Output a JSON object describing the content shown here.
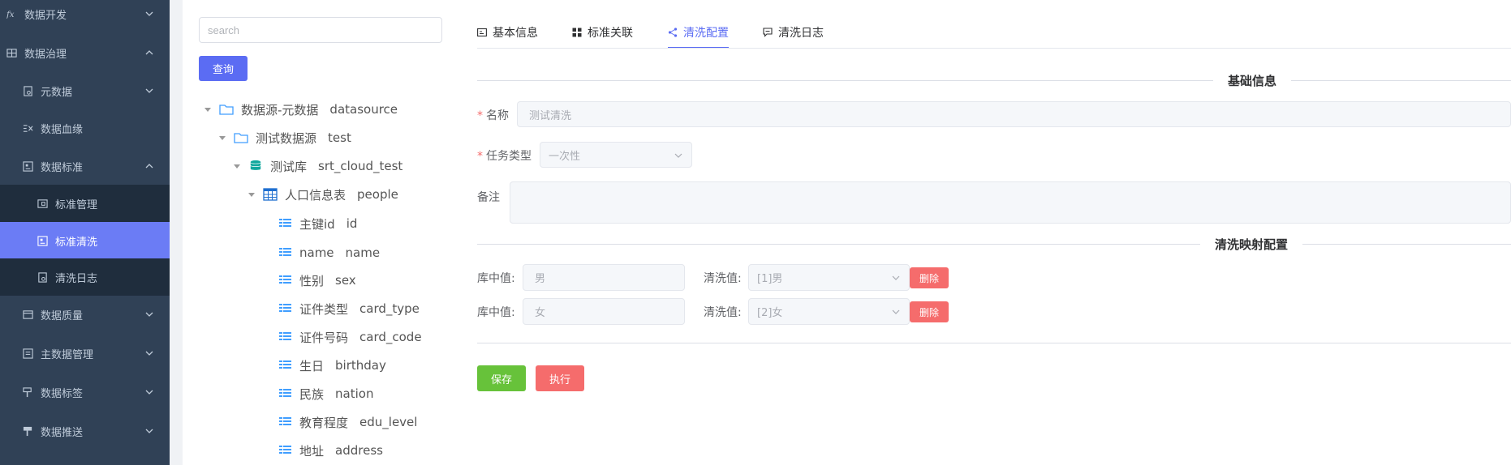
{
  "sidebar": {
    "items": [
      {
        "label": "数据开发",
        "icon": "fx-icon"
      },
      {
        "label": "数据治理",
        "icon": "grid-icon"
      },
      {
        "label": "元数据",
        "icon": "metadata-icon"
      },
      {
        "label": "数据血缘",
        "icon": "lineage-icon"
      },
      {
        "label": "数据标准",
        "icon": "standard-icon"
      },
      {
        "label": "标准管理",
        "icon": "standard-manage-icon"
      },
      {
        "label": "标准清洗",
        "icon": "standard-clean-icon"
      },
      {
        "label": "清洗日志",
        "icon": "clean-log-icon"
      },
      {
        "label": "数据质量",
        "icon": "quality-icon"
      },
      {
        "label": "主数据管理",
        "icon": "master-data-icon"
      },
      {
        "label": "数据标签",
        "icon": "tag-icon"
      },
      {
        "label": "数据推送",
        "icon": "push-icon"
      }
    ],
    "active_bg": "#6b7cf5",
    "bg": "#304156"
  },
  "tree": {
    "search_placeholder": "search",
    "query_label": "查询",
    "nodes": [
      {
        "cn": "数据源-元数据",
        "en": "datasource",
        "icon": "folder-icon"
      },
      {
        "cn": "测试数据源",
        "en": "test",
        "icon": "folder-icon"
      },
      {
        "cn": "测试库",
        "en": "srt_cloud_test",
        "icon": "database-icon"
      },
      {
        "cn": "人口信息表",
        "en": "people",
        "icon": "table-icon"
      },
      {
        "cn": "主键id",
        "en": "id",
        "icon": "column-icon"
      },
      {
        "cn": "name",
        "en": "name",
        "icon": "column-icon"
      },
      {
        "cn": "性别",
        "en": "sex",
        "icon": "column-icon"
      },
      {
        "cn": "证件类型",
        "en": "card_type",
        "icon": "column-icon"
      },
      {
        "cn": "证件号码",
        "en": "card_code",
        "icon": "column-icon"
      },
      {
        "cn": "生日",
        "en": "birthday",
        "icon": "column-icon"
      },
      {
        "cn": "民族",
        "en": "nation",
        "icon": "column-icon"
      },
      {
        "cn": "教育程度",
        "en": "edu_level",
        "icon": "column-icon"
      },
      {
        "cn": "地址",
        "en": "address",
        "icon": "column-icon"
      }
    ]
  },
  "tabs": [
    {
      "label": "基本信息",
      "icon": "info-card-icon"
    },
    {
      "label": "标准关联",
      "icon": "apps-icon"
    },
    {
      "label": "清洗配置",
      "icon": "share-icon"
    },
    {
      "label": "清洗日志",
      "icon": "message-icon"
    }
  ],
  "active_tab": "清洗配置",
  "form": {
    "section_basic": "基础信息",
    "name_label": "名称",
    "name_value": "测试清洗",
    "task_type_label": "任务类型",
    "task_type_value": "一次性",
    "remark_label": "备注",
    "remark_value": "",
    "section_mapping": "清洗映射配置",
    "mappings": [
      {
        "db_label": "库中值:",
        "db_value": "男",
        "clean_label": "清洗值:",
        "clean_value": "[1]男",
        "delete_label": "删除"
      },
      {
        "db_label": "库中值:",
        "db_value": "女",
        "clean_label": "清洗值:",
        "clean_value": "[2]女",
        "delete_label": "删除"
      }
    ],
    "save_label": "保存",
    "run_label": "执行"
  },
  "colors": {
    "primary": "#5b6cf3",
    "success": "#67c23a",
    "danger": "#f56c6c"
  }
}
